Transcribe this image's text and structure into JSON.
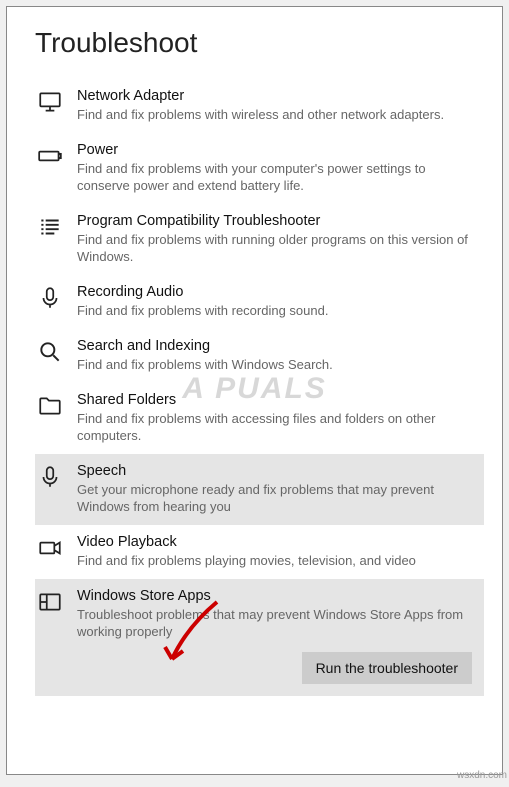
{
  "page": {
    "title": "Troubleshoot"
  },
  "items": [
    {
      "title": "Network Adapter",
      "desc": "Find and fix problems with wireless and other network adapters."
    },
    {
      "title": "Power",
      "desc": "Find and fix problems with your computer's power settings to conserve power and extend battery life."
    },
    {
      "title": "Program Compatibility Troubleshooter",
      "desc": "Find and fix problems with running older programs on this version of Windows."
    },
    {
      "title": "Recording Audio",
      "desc": "Find and fix problems with recording sound."
    },
    {
      "title": "Search and Indexing",
      "desc": "Find and fix problems with Windows Search."
    },
    {
      "title": "Shared Folders",
      "desc": "Find and fix problems with accessing files and folders on other computers."
    },
    {
      "title": "Speech",
      "desc": "Get your microphone ready and fix problems that may prevent Windows from hearing you"
    },
    {
      "title": "Video Playback",
      "desc": "Find and fix problems playing movies, television, and video"
    },
    {
      "title": "Windows Store Apps",
      "desc": "Troubleshoot problems that may prevent Windows Store Apps from working properly"
    }
  ],
  "button": {
    "run": "Run the troubleshooter"
  },
  "watermark": "A    PUALS",
  "footer": "wsxdn.com"
}
